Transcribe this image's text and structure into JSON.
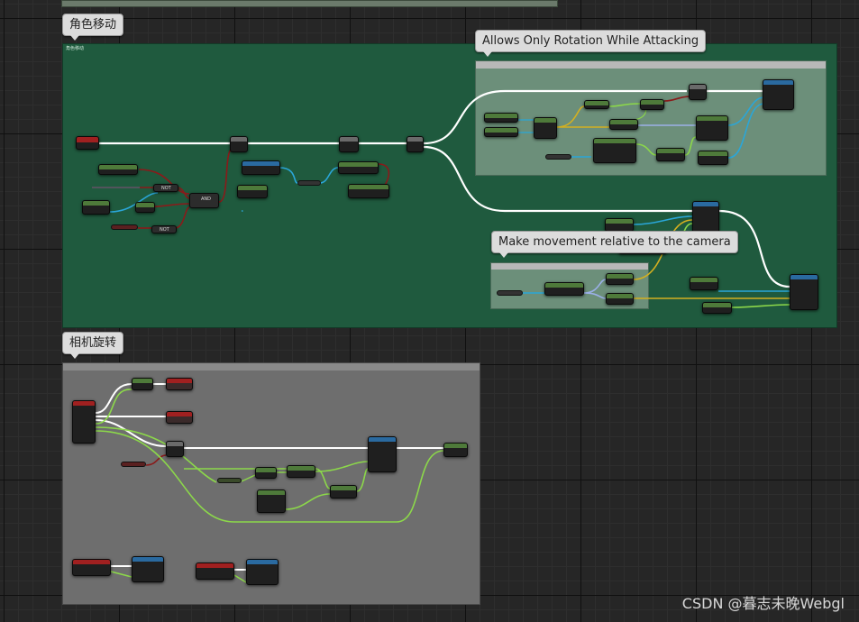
{
  "comments": {
    "character_movement": {
      "label": "角色移动",
      "inner_label": "角色移动"
    },
    "rotation_while_attacking": {
      "label": "Allows Only Rotation While Attacking"
    },
    "movement_relative_camera": {
      "label": "Make movement relative to the camera"
    },
    "camera_rotation": {
      "label": "相机旋转"
    }
  },
  "nodes": {
    "not_1": "NOT",
    "not_2": "NOT",
    "and": "AND"
  },
  "colors": {
    "group_green": "#1f5a3e",
    "group_gray": "#6e6e6e",
    "exec_wire": "#ffffff",
    "float_wire": "#2aa6d8",
    "bool_wire": "#8a1a1a",
    "vector_wire": "#d4b020",
    "rotator_wire": "#9bb0e8",
    "float_green_wire": "#8cd84a"
  },
  "watermark": "CSDN @暮志未晚Webgl"
}
